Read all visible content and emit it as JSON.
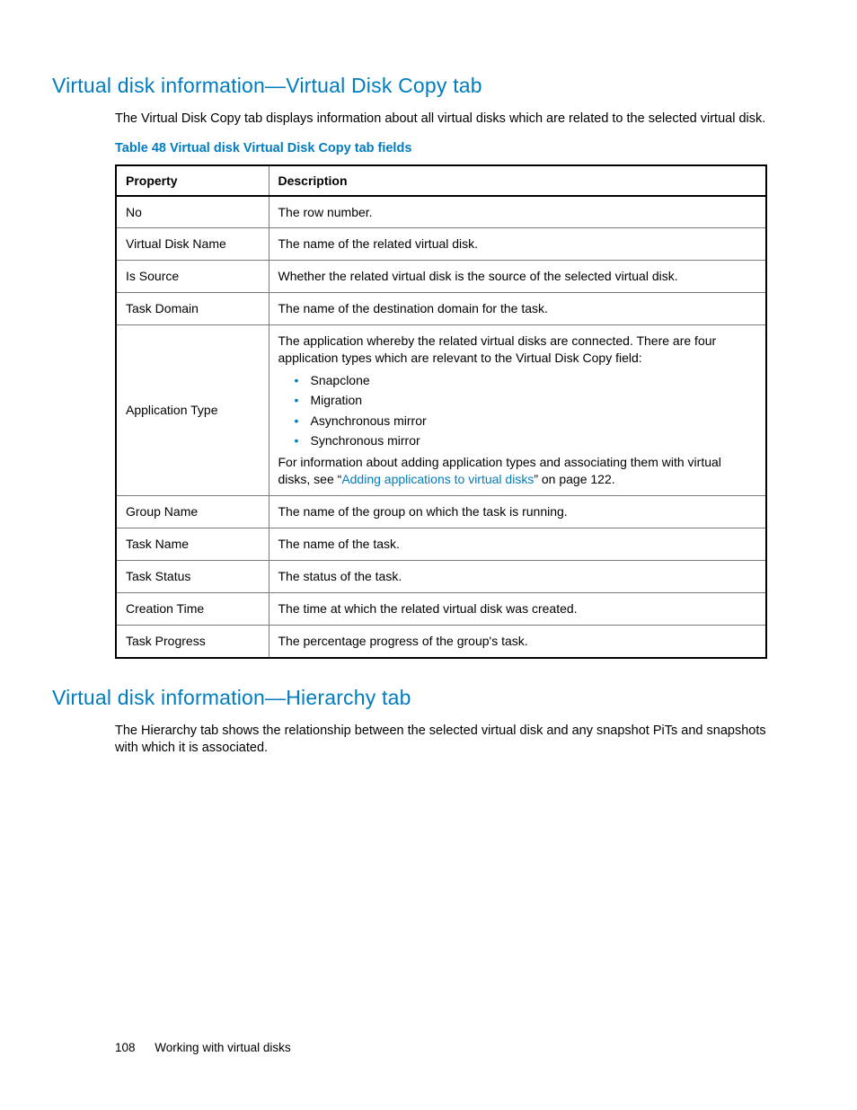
{
  "section1": {
    "heading": "Virtual disk information—Virtual Disk Copy tab",
    "intro": "The Virtual Disk Copy tab displays information about all virtual disks which are related to the selected virtual disk.",
    "table_caption": "Table 48 Virtual disk Virtual Disk Copy tab fields",
    "col_property": "Property",
    "col_description": "Description",
    "rows": {
      "no": {
        "p": "No",
        "d": "The row number."
      },
      "vdn": {
        "p": "Virtual Disk Name",
        "d": "The name of the related virtual disk."
      },
      "iss": {
        "p": "Is Source",
        "d": "Whether the related virtual disk is the source of the selected virtual disk."
      },
      "td": {
        "p": "Task Domain",
        "d": "The name of the destination domain for the task."
      },
      "app": {
        "p": "Application Type",
        "lead": "The application whereby the related virtual disks are connected. There are four application types which are relevant to the Virtual Disk Copy field:",
        "b1": "Snapclone",
        "b2": "Migration",
        "b3": "Asynchronous mirror",
        "b4": "Synchronous mirror",
        "tail_pre": "For information about adding application types and associating them with virtual disks, see “",
        "link": "Adding applications to virtual disks",
        "tail_post": "” on page 122."
      },
      "gn": {
        "p": "Group Name",
        "d": "The name of the group on which the task is running."
      },
      "tn": {
        "p": "Task Name",
        "d": "The name of the task."
      },
      "ts": {
        "p": "Task Status",
        "d": "The status of the task."
      },
      "ct": {
        "p": "Creation Time",
        "d": "The time at which the related virtual disk was created."
      },
      "tp": {
        "p": "Task Progress",
        "d": "The percentage progress of the group's task."
      }
    }
  },
  "section2": {
    "heading": "Virtual disk information—Hierarchy tab",
    "intro": "The Hierarchy tab shows the relationship between the selected virtual disk and any snapshot PiTs and snapshots with which it is associated."
  },
  "footer": {
    "page_number": "108",
    "chapter": "Working with virtual disks"
  }
}
